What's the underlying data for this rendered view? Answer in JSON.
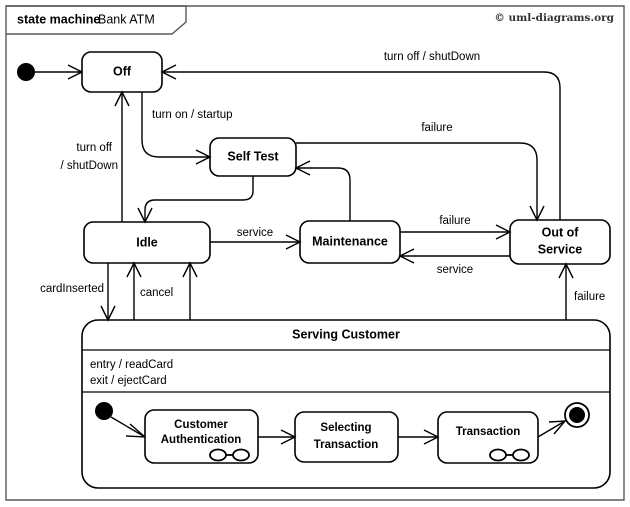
{
  "frame": {
    "keyword": "state machine",
    "name": "Bank ATM",
    "copyright": "© uml-diagrams.org"
  },
  "states": {
    "off": {
      "label": "Off"
    },
    "self_test": {
      "label": "Self Test"
    },
    "idle": {
      "label": "Idle"
    },
    "maintenance": {
      "label": "Maintenance"
    },
    "out_of_service_line1": {
      "label": "Out of"
    },
    "out_of_service_line2": {
      "label": "Service"
    },
    "serving_customer": {
      "title": "Serving Customer",
      "entry": "entry / readCard",
      "exit": "exit / ejectCard"
    },
    "customer_authentication_line1": {
      "label": "Customer"
    },
    "customer_authentication_line2": {
      "label": "Authentication"
    },
    "selecting_transaction_line1": {
      "label": "Selecting"
    },
    "selecting_transaction_line2": {
      "label": "Transaction"
    },
    "transaction": {
      "label": "Transaction"
    }
  },
  "transitions": {
    "turn_on": "turn on / startup",
    "turn_off_top": "turn off / shutDown",
    "turn_off_left_line1": "turn off",
    "turn_off_left_line2": "/ shutDown",
    "service_idle_maint": "service",
    "failure_selftest_oos": "failure",
    "failure_maint_oos": "failure",
    "service_oos_maint": "service",
    "failure_serving_oos": "failure",
    "card_inserted": "cardInserted",
    "cancel": "cancel"
  },
  "colors": {
    "stroke": "#000000",
    "frame_stroke": "#5a5a5a",
    "background": "#ffffff",
    "copyright_fill": "#333333"
  }
}
